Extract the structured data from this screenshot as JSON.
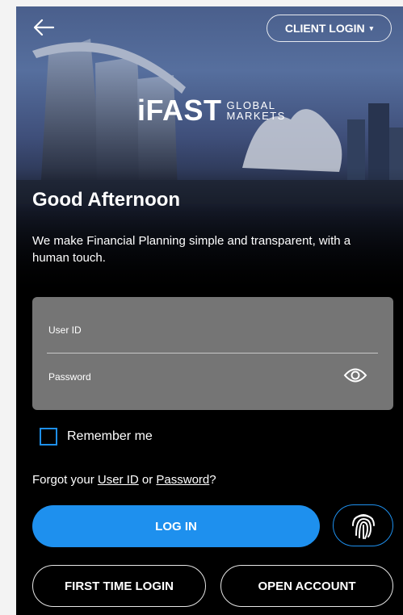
{
  "header": {
    "back_icon": "arrow-left-icon",
    "client_login_label": "CLIENT LOGIN",
    "client_login_caret": "▾"
  },
  "logo": {
    "main": "iFAST",
    "sub_top": "GLOBAL",
    "sub_bottom": "MARKETS"
  },
  "greeting": "Good Afternoon",
  "tagline": "We make Financial Planning simple and transparent, with a human touch.",
  "form": {
    "userid_label": "User ID",
    "password_label": "Password",
    "eye_icon": "eye-icon"
  },
  "remember_label": "Remember me",
  "forgot": {
    "prefix": "Forgot your ",
    "userid_link": "User ID",
    "mid": " or ",
    "password_link": "Password",
    "suffix": "?"
  },
  "buttons": {
    "login": "LOG IN",
    "fingerprint_icon": "fingerprint-icon",
    "first_time_login": "FIRST TIME LOGIN",
    "open_account": "OPEN ACCOUNT"
  },
  "colors": {
    "accent": "#1e90ee",
    "form_bg": "#757575",
    "background": "#000000"
  }
}
